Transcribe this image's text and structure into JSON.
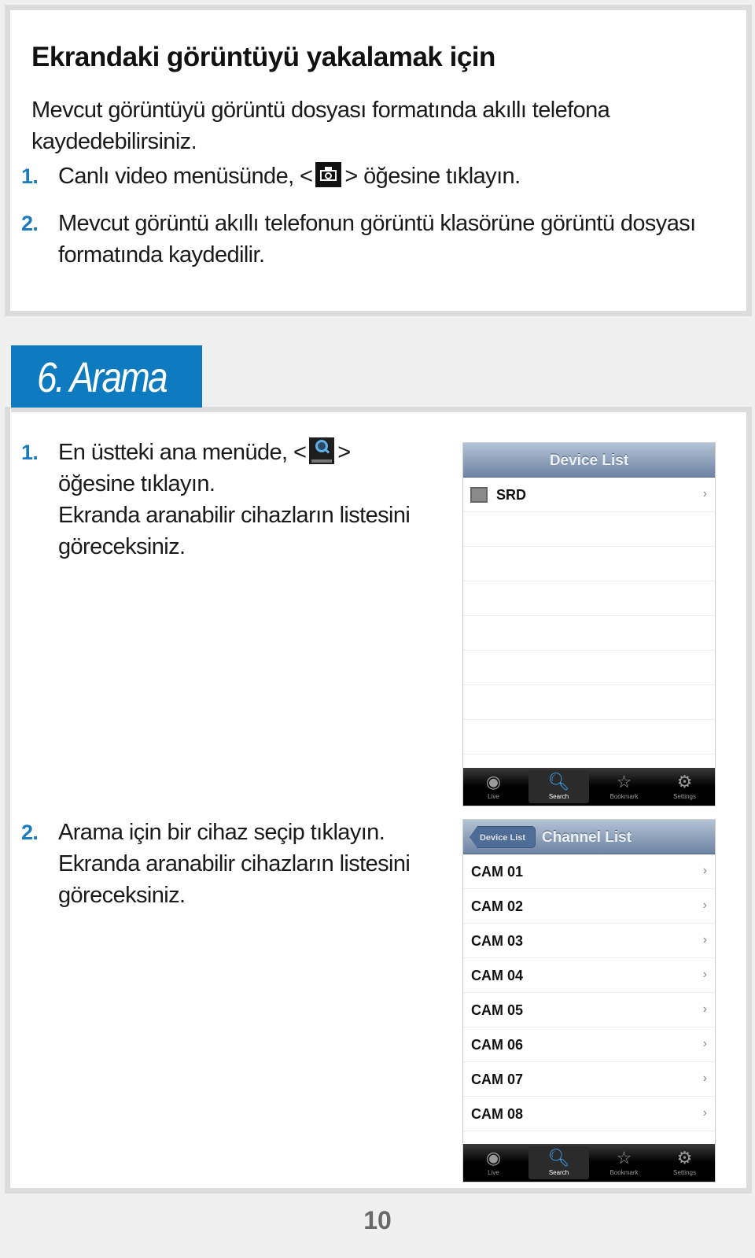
{
  "capture_section": {
    "title": "Ekrandaki görüntüyü yakalamak için",
    "intro": "Mevcut görüntüyü görüntü dosyası formatında akıllı telefona kaydedebilirsiniz.",
    "steps": [
      {
        "num": "1.",
        "before": "Canlı video menüsünde, <",
        "icon": "camera-icon",
        "after": "> öğesine tıklayın."
      },
      {
        "num": "2.",
        "text": "Mevcut görüntü akıllı telefonun görüntü klasörüne görüntü dosyası formatında kaydedilir."
      }
    ]
  },
  "search_section": {
    "heading": "6. Arama",
    "accent_color": "#0e7bc0",
    "steps": [
      {
        "num": "1.",
        "before": "En üstteki ana menüde, <",
        "icon": "search-icon",
        "after": ">",
        "line2": "öğesine tıklayın.",
        "line3": "Ekranda aranabilir cihazların listesini göreceksiniz."
      },
      {
        "num": "2.",
        "line1": "Arama için bir cihaz seçip tıklayın.",
        "line2": "Ekranda aranabilir cihazların listesini göreceksiniz."
      }
    ]
  },
  "device_list_screen": {
    "title": "Device List",
    "items": [
      {
        "label": "SRD",
        "icon": "device-icon"
      }
    ],
    "tabs": [
      {
        "label": "Live",
        "icon": "live-icon"
      },
      {
        "label": "Search",
        "icon": "search-icon",
        "active": true
      },
      {
        "label": "Bookmark",
        "icon": "star-icon"
      },
      {
        "label": "Settings",
        "icon": "gear-icon"
      }
    ]
  },
  "channel_list_screen": {
    "back_label": "Device List",
    "title": "Channel List",
    "items": [
      "CAM 01",
      "CAM 02",
      "CAM 03",
      "CAM 04",
      "CAM 05",
      "CAM 06",
      "CAM 07",
      "CAM 08"
    ],
    "chevron": "›",
    "tabs": [
      {
        "label": "Live",
        "icon": "live-icon"
      },
      {
        "label": "Search",
        "icon": "search-icon",
        "active": true
      },
      {
        "label": "Bookmark",
        "icon": "star-icon"
      },
      {
        "label": "Settings",
        "icon": "gear-icon"
      }
    ]
  },
  "page_number": "10"
}
